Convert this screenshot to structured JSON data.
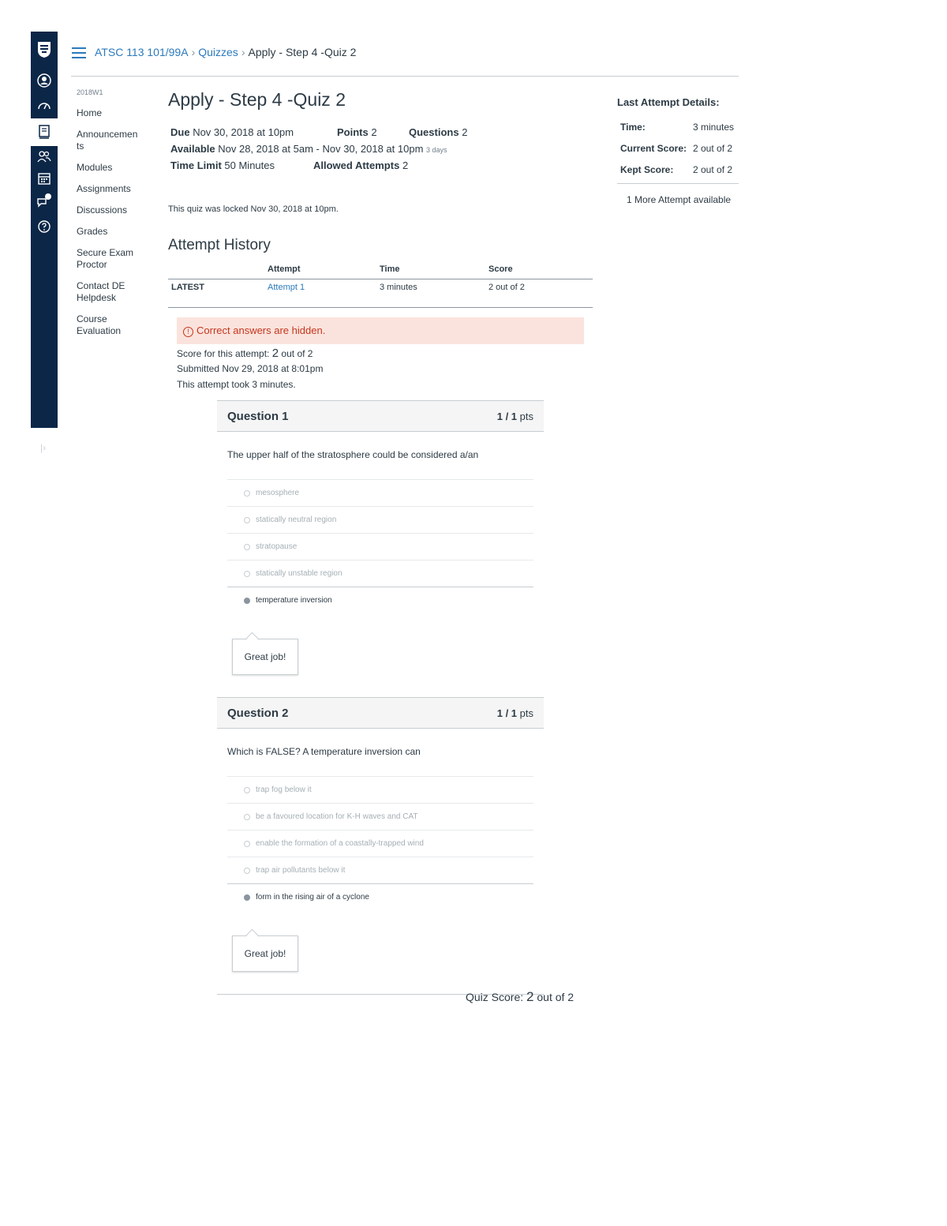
{
  "global_nav": {
    "icons": [
      "logo-icon",
      "account-icon",
      "dashboard-icon",
      "courses-icon",
      "groups-icon",
      "calendar-icon",
      "inbox-icon",
      "help-icon",
      "collapse-icon"
    ],
    "inbox_badge": "",
    "collapse_glyph": "|›"
  },
  "breadcrumb": {
    "course": "ATSC 113 101/99A",
    "section": "Quizzes",
    "current": "Apply - Step 4 -Quiz 2"
  },
  "course_nav": {
    "term": "2018W1",
    "items": [
      "Home",
      "Announcemen ts",
      "Modules",
      "Assignments",
      "Discussions",
      "Grades",
      "Secure Exam Proctor",
      "Contact DE Helpdesk",
      "Course Evaluation"
    ]
  },
  "quiz": {
    "title": "Apply - Step 4 -Quiz 2",
    "due_label": "Due",
    "due_value": "Nov 30, 2018 at 10pm",
    "points_label": "Points",
    "points_value": "2",
    "questions_label": "Questions",
    "questions_value": "2",
    "available_label": "Available",
    "available_value": "Nov 28, 2018 at 5am - Nov 30, 2018 at 10pm",
    "available_duration": "3 days",
    "time_limit_label": "Time Limit",
    "time_limit_value": "50 Minutes",
    "allowed_attempts_label": "Allowed Attempts",
    "allowed_attempts_value": "2",
    "locked_message": "This quiz was locked Nov 30, 2018 at 10pm."
  },
  "attempt_history": {
    "heading": "Attempt History",
    "columns": [
      "",
      "Attempt",
      "Time",
      "Score"
    ],
    "rows": [
      {
        "tag": "LATEST",
        "attempt": "Attempt 1",
        "time": "3 minutes",
        "score": "2 out of 2"
      }
    ]
  },
  "alert": {
    "icon": "!",
    "text": "Correct answers are hidden."
  },
  "attempt_info": {
    "score_prefix": "Score for this attempt:",
    "score_value": "2",
    "score_suffix": "out of 2",
    "submitted": "Submitted Nov 29, 2018 at 8:01pm",
    "duration": "This attempt took 3 minutes."
  },
  "questions": [
    {
      "title": "Question 1",
      "points": "1 / 1",
      "points_unit": "pts",
      "text": "The upper half of the stratosphere could be considered a/an",
      "answers": [
        "mesosphere",
        "statically neutral region",
        "stratopause",
        "statically unstable region",
        "temperature inversion"
      ],
      "selected_index": 4,
      "comment": "Great job!"
    },
    {
      "title": "Question 2",
      "points": "1 / 1",
      "points_unit": "pts",
      "text": "Which is FALSE?  A temperature inversion can",
      "answers": [
        "trap fog below it",
        "be a favoured location for K-H waves and CAT",
        "enable the formation of a coastally-trapped wind",
        "trap air pollutants below it",
        "form in the rising air of a cyclone"
      ],
      "selected_index": 4,
      "comment": "Great job!"
    }
  ],
  "quiz_score": {
    "prefix": "Quiz Score:",
    "value": "2",
    "suffix": "out of 2"
  },
  "sidebar": {
    "title": "Last Attempt Details:",
    "time_label": "Time:",
    "time_value": "3 minutes",
    "current_label": "Current Score:",
    "current_value": "2 out of 2",
    "kept_label": "Kept Score:",
    "kept_value": "2 out of 2",
    "more_attempts": "1 More Attempt available"
  },
  "colors": {
    "nav_bg": "#0b2647",
    "link": "#2b7abc",
    "alert_bg": "#fbe3dd",
    "alert_text": "#c4361e"
  }
}
